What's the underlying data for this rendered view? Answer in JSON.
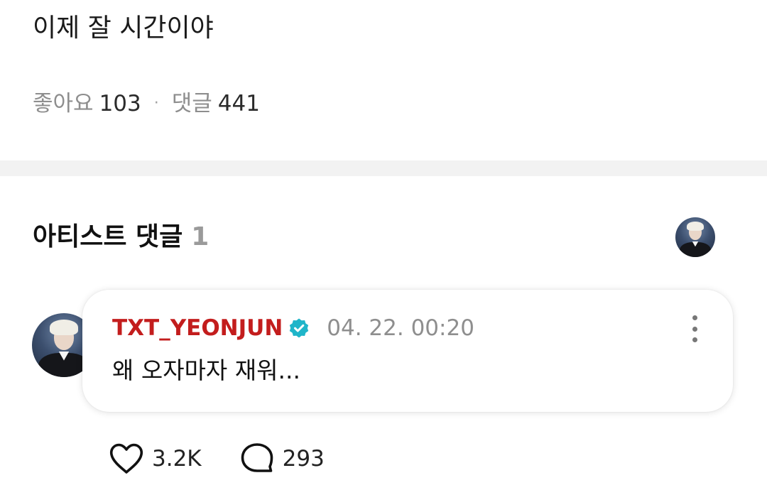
{
  "post": {
    "text": "이제 잘 시간이야",
    "likes_label": "좋아요",
    "likes_count": "103",
    "separator": "·",
    "comments_label": "댓글",
    "comments_count": "441"
  },
  "artist_comments": {
    "title": "아티스트 댓글",
    "count": "1",
    "comment": {
      "author": "TXT_YEONJUN",
      "timestamp": "04. 22. 00:20",
      "text": "왜 오자마자 재워...",
      "likes": "3.2K",
      "replies": "293"
    }
  },
  "colors": {
    "author": "#c31d1d",
    "verified": "#1fb5c9",
    "muted": "#8e8e8e",
    "divider": "#f2f2f2"
  },
  "icons": [
    "verified-badge-icon",
    "more-vertical-icon",
    "heart-icon",
    "comment-bubble-icon"
  ]
}
